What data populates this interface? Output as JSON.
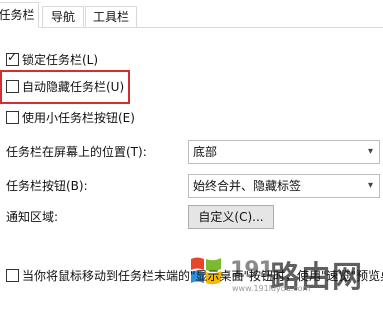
{
  "tabs": [
    "任务栏",
    "导航",
    "工具栏"
  ],
  "options": {
    "lock_taskbar": {
      "label": "锁定任务栏(L)",
      "checked": true
    },
    "auto_hide": {
      "label": "自动隐藏任务栏(U)",
      "checked": false
    },
    "small_buttons": {
      "label": "使用小任务栏按钮(E)",
      "checked": false
    }
  },
  "position": {
    "label": "任务栏在屏幕上的位置(T):",
    "value": "底部"
  },
  "buttons": {
    "label": "任务栏按钮(B):",
    "value": "始终合并、隐藏标签"
  },
  "notify": {
    "label": "通知区域:",
    "button": "自定义(C)..."
  },
  "peek": {
    "label": "当你将鼠标移动到任务栏末端的\"显示桌面\"按钮时，使用\"速览\"预览桌",
    "checked": false
  },
  "watermark": {
    "number": "191",
    "text": "路由网",
    "url": "www.191luyou.com"
  },
  "colors": {
    "highlight": "#d32f2f"
  }
}
